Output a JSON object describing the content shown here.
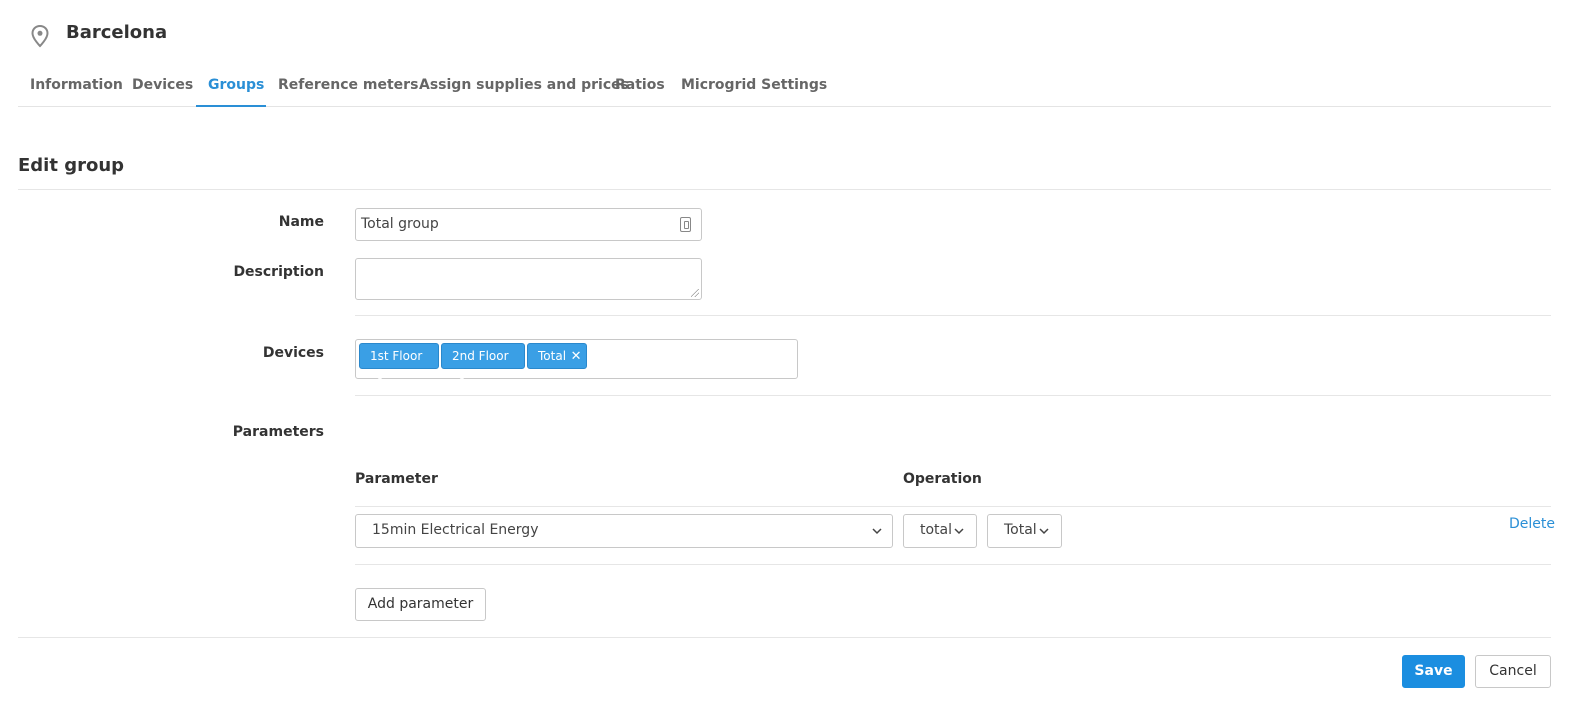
{
  "header": {
    "title": "Barcelona",
    "icon": "location-pin-icon"
  },
  "tabs": [
    {
      "label": "Information",
      "active": false
    },
    {
      "label": "Devices",
      "active": false
    },
    {
      "label": "Groups",
      "active": true
    },
    {
      "label": "Reference meters",
      "active": false
    },
    {
      "label": "Assign supplies and prices",
      "active": false
    },
    {
      "label": "Ratios",
      "active": false
    },
    {
      "label": "Microgrid Settings",
      "active": false
    }
  ],
  "form": {
    "title": "Edit group",
    "name_label": "Name",
    "name_value": "Total group",
    "description_label": "Description",
    "description_value": "",
    "devices_label": "Devices",
    "devices": [
      "1st Floor",
      "2nd Floor",
      "Total"
    ],
    "parameters_label": "Parameters",
    "parameters": {
      "col_parameter": "Parameter",
      "col_operation": "Operation",
      "rows": [
        {
          "parameter": "15min Electrical Energy",
          "operation": "total",
          "aggregation": "Total",
          "delete_label": "Delete"
        }
      ],
      "add_label": "Add parameter"
    }
  },
  "actions": {
    "save_label": "Save",
    "cancel_label": "Cancel"
  },
  "colors": {
    "accent": "#2a8fd6",
    "tag": "#3a9fe5",
    "primary_button": "#1b8ee0"
  }
}
